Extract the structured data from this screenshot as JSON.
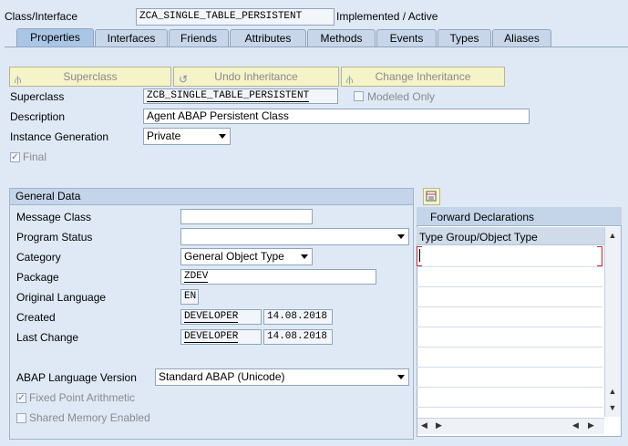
{
  "header": {
    "class_label": "Class/Interface",
    "class_value": "ZCA_SINGLE_TABLE_PERSISTENT",
    "status": "Implemented / Active"
  },
  "tabs": [
    {
      "label": "Properties",
      "active": true
    },
    {
      "label": "Interfaces"
    },
    {
      "label": "Friends"
    },
    {
      "label": "Attributes"
    },
    {
      "label": "Methods"
    },
    {
      "label": "Events"
    },
    {
      "label": "Types"
    },
    {
      "label": "Aliases"
    }
  ],
  "toolbar": {
    "superclass": "Superclass",
    "undo_inheritance": "Undo Inheritance",
    "change_inheritance": "Change Inheritance"
  },
  "props": {
    "superclass_label": "Superclass",
    "superclass_value": "ZCB_SINGLE_TABLE_PERSISTENT",
    "modeled_only": "Modeled Only",
    "description_label": "Description",
    "description_value": "Agent ABAP Persistent Class",
    "instance_gen_label": "Instance Generation",
    "instance_gen_value": "Private",
    "final": "Final"
  },
  "general": {
    "title": "General Data",
    "message_class_label": "Message Class",
    "message_class_value": "",
    "program_status_label": "Program Status",
    "program_status_value": "",
    "category_label": "Category",
    "category_value": "General Object Type",
    "package_label": "Package",
    "package_value": "ZDEV",
    "orig_lang_label": "Original Language",
    "orig_lang_value": "EN",
    "created_label": "Created",
    "created_user": "DEVELOPER",
    "created_date": "14.08.2018",
    "last_change_label": "Last Change",
    "last_change_user": "DEVELOPER",
    "last_change_date": "14.08.2018",
    "abap_version_label": "ABAP Language Version",
    "abap_version_value": "Standard ABAP (Unicode)",
    "fixed_point": "Fixed Point Arithmetic",
    "shared_memory": "Shared Memory Enabled"
  },
  "forward": {
    "title": "Forward Declarations",
    "column": "Type Group/Object Type"
  }
}
